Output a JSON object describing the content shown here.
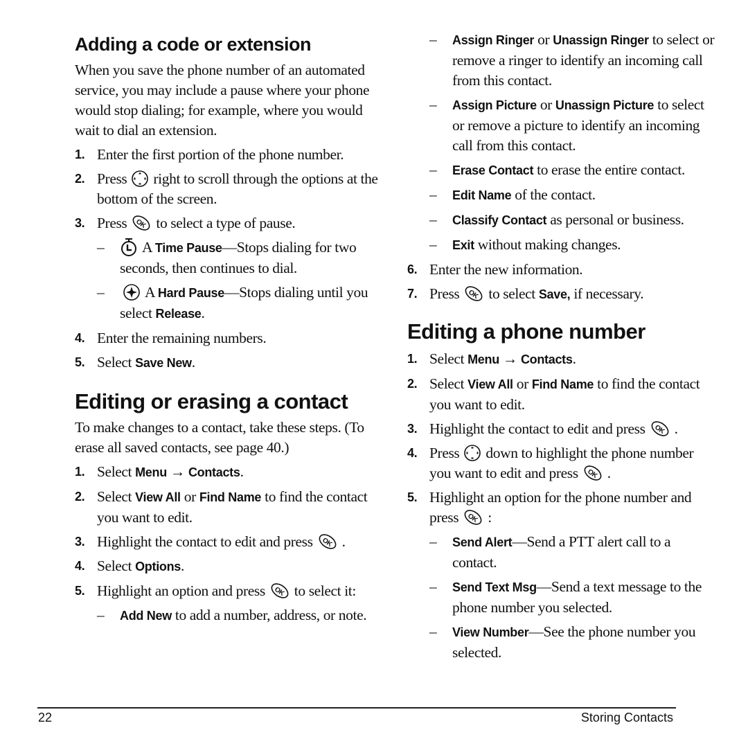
{
  "left_column": {
    "section1": {
      "heading": "Adding a code or extension",
      "intro": "When you save the phone number of an automated service, you may include a pause where your phone would stop dialing; for example, where you would wait to dial an extension.",
      "steps": [
        {
          "num": "1.",
          "text": "Enter the first portion of the phone number."
        },
        {
          "num": "2.",
          "pre": "Press",
          "icon": "navigation-key-icon",
          "post": "right to scroll through the options at the bottom of the screen."
        },
        {
          "num": "3.",
          "pre": "Press",
          "icon": "ok-key-icon",
          "post": "to select a type of pause."
        },
        {
          "num": "4.",
          "text": "Enter the remaining numbers."
        },
        {
          "num": "5.",
          "pre": "Select ",
          "ui": "Save New",
          "post": "."
        }
      ],
      "pause_options": [
        {
          "dash": "–",
          "icon": "timer-icon",
          "article": "A ",
          "ui": "Time Pause",
          "desc": "—Stops dialing for two seconds, then continues to dial."
        },
        {
          "dash": "–",
          "icon": "hard-pause-icon",
          "article": "A ",
          "ui": "Hard Pause",
          "desc": "—Stops dialing until you select ",
          "ui2": "Release",
          "end": "."
        }
      ]
    },
    "section2": {
      "heading": "Editing or erasing a contact",
      "intro": "To make changes to a contact, take these steps. (To erase all saved contacts, see page 40.)",
      "steps": [
        {
          "num": "1.",
          "pre": "Select ",
          "ui": "Menu",
          "arrow": " → ",
          "ui2": "Contacts",
          "post": "."
        },
        {
          "num": "2.",
          "pre": "Select ",
          "ui": "View All",
          "mid": " or ",
          "ui2": "Find Name",
          "post": " to find the contact you want to edit."
        },
        {
          "num": "3.",
          "pre": "Highlight the contact to edit and press",
          "icon": "ok-key-icon",
          "post": "."
        },
        {
          "num": "4.",
          "pre": "Select ",
          "ui": "Options",
          "post": "."
        },
        {
          "num": "5.",
          "pre": "Highlight an option and press",
          "icon": "ok-key-icon",
          "post": "to select it:"
        }
      ],
      "options": [
        {
          "dash": "–",
          "ui": "Add New",
          "desc": " to add a number, address, or note."
        }
      ]
    }
  },
  "right_column": {
    "options_continued": [
      {
        "dash": "–",
        "ui": "Assign Ringer",
        "mid": " or ",
        "ui2": "Unassign Ringer",
        "desc": " to select or remove a ringer to identify an incoming call from this contact."
      },
      {
        "dash": "–",
        "ui": "Assign Picture",
        "mid": " or ",
        "ui2": "Unassign Picture",
        "desc": " to select or remove a picture to identify an incoming call from this contact."
      },
      {
        "dash": "–",
        "ui": "Erase Contact",
        "desc": " to erase the entire contact."
      },
      {
        "dash": "–",
        "ui": "Edit Name",
        "desc": " of the contact."
      },
      {
        "dash": "–",
        "ui": "Classify Contact",
        "desc": " as personal or business."
      },
      {
        "dash": "–",
        "ui": "Exit",
        "desc": " without making changes."
      }
    ],
    "steps_continued": [
      {
        "num": "6.",
        "text": "Enter the new information."
      },
      {
        "num": "7.",
        "pre": "Press",
        "icon": "ok-key-icon",
        "post": "to select ",
        "ui": "Save,",
        "end": " if necessary."
      }
    ],
    "section3": {
      "heading": "Editing a phone number",
      "steps": [
        {
          "num": "1.",
          "pre": "Select ",
          "ui": "Menu",
          "arrow": " → ",
          "ui2": "Contacts",
          "post": "."
        },
        {
          "num": "2.",
          "pre": "Select ",
          "ui": "View All",
          "mid": " or ",
          "ui2": "Find Name",
          "post": " to find the contact you want to edit."
        },
        {
          "num": "3.",
          "pre": "Highlight the contact to edit and press",
          "icon": "ok-key-icon",
          "post": "."
        },
        {
          "num": "4.",
          "pre": "Press",
          "icon": "navigation-key-icon",
          "mid": "down to highlight the phone number you want to edit and press",
          "icon2": "ok-key-icon",
          "post": "."
        },
        {
          "num": "5.",
          "pre": "Highlight an option for the phone number and press",
          "icon": "ok-key-icon",
          "post": ":"
        }
      ],
      "options": [
        {
          "dash": "–",
          "ui": "Send Alert",
          "desc": "—Send a PTT alert call to a contact."
        },
        {
          "dash": "–",
          "ui": "Send Text Msg",
          "desc": "—Send a text message to the phone number you selected."
        },
        {
          "dash": "–",
          "ui": "View Number",
          "desc": "—See the phone number you selected."
        }
      ]
    }
  },
  "footer": {
    "page_number": "22",
    "section_title": "Storing Contacts"
  }
}
